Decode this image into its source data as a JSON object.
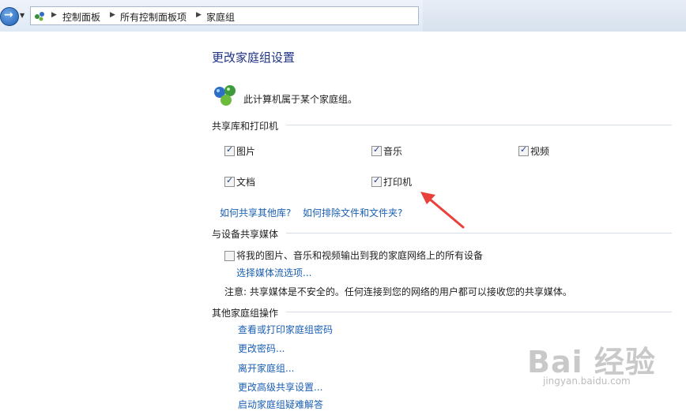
{
  "address_bar": {
    "crumbs": [
      "控制面板",
      "所有控制面板项",
      "家庭组"
    ]
  },
  "page": {
    "title": "更改家庭组设置",
    "status_text": "此计算机属于某个家庭组。",
    "share_section": {
      "heading": "共享库和打印机",
      "items": [
        {
          "label": "图片",
          "checked": true
        },
        {
          "label": "音乐",
          "checked": true
        },
        {
          "label": "视频",
          "checked": true
        },
        {
          "label": "文档",
          "checked": true
        },
        {
          "label": "打印机",
          "checked": true
        }
      ],
      "links": [
        "如何共享其他库?",
        "如何排除文件和文件夹?"
      ]
    },
    "media_section": {
      "heading": "与设备共享媒体",
      "checkbox_label": "将我的图片、音乐和视频输出到我的家庭网络上的所有设备",
      "checked": false,
      "link": "选择媒体流选项...",
      "note": "注意: 共享媒体是不安全的。任何连接到您的网络的用户都可以接收您的共享媒体。"
    },
    "other_section": {
      "heading": "其他家庭组操作",
      "links": [
        "查看或打印家庭组密码",
        "更改密码...",
        "离开家庭组...",
        "更改高级共享设置...",
        "启动家庭组疑难解答"
      ]
    }
  },
  "watermark": {
    "brand": "Bai 经验",
    "url": "jingyan.baidu.com"
  },
  "colors": {
    "title": "#1e3287",
    "link": "#1a5fb4",
    "annotation_arrow": "#e8403b"
  }
}
